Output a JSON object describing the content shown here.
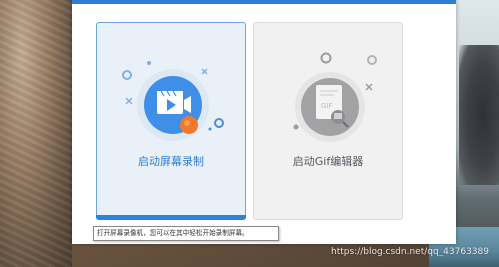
{
  "window": {
    "accent_color": "#2d7fd2"
  },
  "cards": {
    "record": {
      "label": "启动屏幕录制",
      "icon": "video-camera-icon"
    },
    "gif": {
      "label": "启动Gif编辑器",
      "icon": "gif-editor-icon",
      "icon_text": "GIF"
    }
  },
  "tooltip": {
    "text": "打开屏幕录像机，您可以在其中轻松开始录制屏幕。"
  },
  "watermark": {
    "text": "https://blog.csdn.net/qq_43763389"
  }
}
